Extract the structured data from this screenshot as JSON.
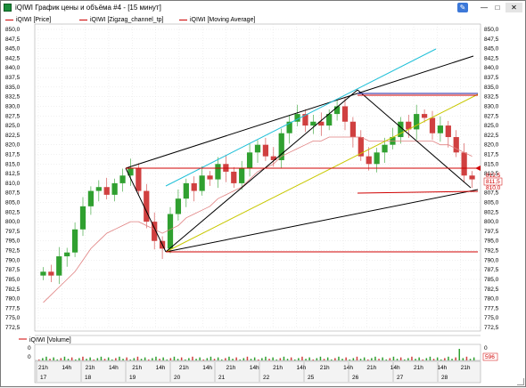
{
  "window": {
    "title": "iQIWI График цены и объёма #4 - [15 минут]"
  },
  "legend": {
    "price": "iQIWI [Price]",
    "zigzag": "iQIWI [Zigzag_channel_tp]",
    "ma": "iQIWI [Moving Average]",
    "volume": "iQIWI [Volume]"
  },
  "price_axis": {
    "ticks": [
      "850,0",
      "847,5",
      "845,0",
      "842,5",
      "840,0",
      "837,5",
      "835,0",
      "832,5",
      "830,0",
      "827,5",
      "825,0",
      "822,5",
      "820,0",
      "817,5",
      "815,0",
      "812,5",
      "810,0",
      "807,5",
      "805,0",
      "802,5",
      "800,0",
      "797,5",
      "795,0",
      "792,5",
      "790,0",
      "787,5",
      "785,0",
      "782,5",
      "780,0",
      "777,5",
      "775,0",
      "772,5"
    ],
    "marker_a": "812,5",
    "marker_b": "811,5",
    "marker_c": "810,0"
  },
  "volume_axis": {
    "ticks": [
      "0",
      "0"
    ],
    "marker": "596"
  },
  "time_axis": {
    "hours": [
      "21h",
      "14h",
      "21h",
      "14h",
      "21h",
      "14h",
      "21h",
      "14h",
      "21h",
      "14h",
      "21h",
      "14h",
      "21h",
      "14h",
      "21h",
      "14h",
      "21h",
      "14h",
      "21h"
    ],
    "days": [
      "17",
      "18",
      "19",
      "20",
      "21",
      "22",
      "25",
      "26",
      "27",
      "28"
    ]
  },
  "colors": {
    "price_line": "#d00000",
    "support_line": "#000000",
    "cyan_line": "#20c0d8",
    "yellow_line": "#c8c800",
    "blue_line": "#2020a0",
    "ma_line": "#e08080",
    "candle_up": "#30a030",
    "candle_down": "#d04040"
  },
  "chart_data": {
    "type": "line",
    "title": "",
    "ylim": [
      772.5,
      850.0
    ],
    "levels": {
      "horizontal_top": 833.5,
      "horizontal_mid": 814.0,
      "horizontal_low": 808.5,
      "horizontal_bottom": 792.5,
      "current_price": 811.5
    },
    "series": [
      {
        "name": "iQIWI [Price]",
        "values": [
          787,
          786,
          791,
          792,
          798,
          804,
          808,
          809,
          807,
          810,
          812,
          814,
          808,
          800,
          795,
          793,
          802,
          806,
          810,
          808,
          812,
          811,
          815,
          813,
          810,
          814,
          818,
          820,
          817,
          816,
          823,
          826,
          828,
          825,
          826,
          825,
          828,
          830,
          826,
          822,
          817,
          815,
          818,
          820,
          822,
          826,
          824,
          828,
          827,
          823,
          825,
          822,
          818,
          812,
          811
        ]
      },
      {
        "name": "iQIWI [Moving Average]",
        "values": [
          779,
          781,
          783,
          785,
          787,
          790,
          793,
          795,
          797,
          798,
          799,
          800,
          800,
          799,
          798,
          797,
          798,
          799,
          801,
          802,
          803,
          804,
          806,
          807,
          808,
          809,
          811,
          813,
          814,
          815,
          817,
          818,
          819,
          820,
          821,
          821,
          822,
          822,
          822,
          822,
          822,
          821,
          821,
          821,
          821,
          821,
          821,
          821,
          821,
          821,
          820,
          820,
          819,
          818,
          817
        ]
      }
    ]
  }
}
